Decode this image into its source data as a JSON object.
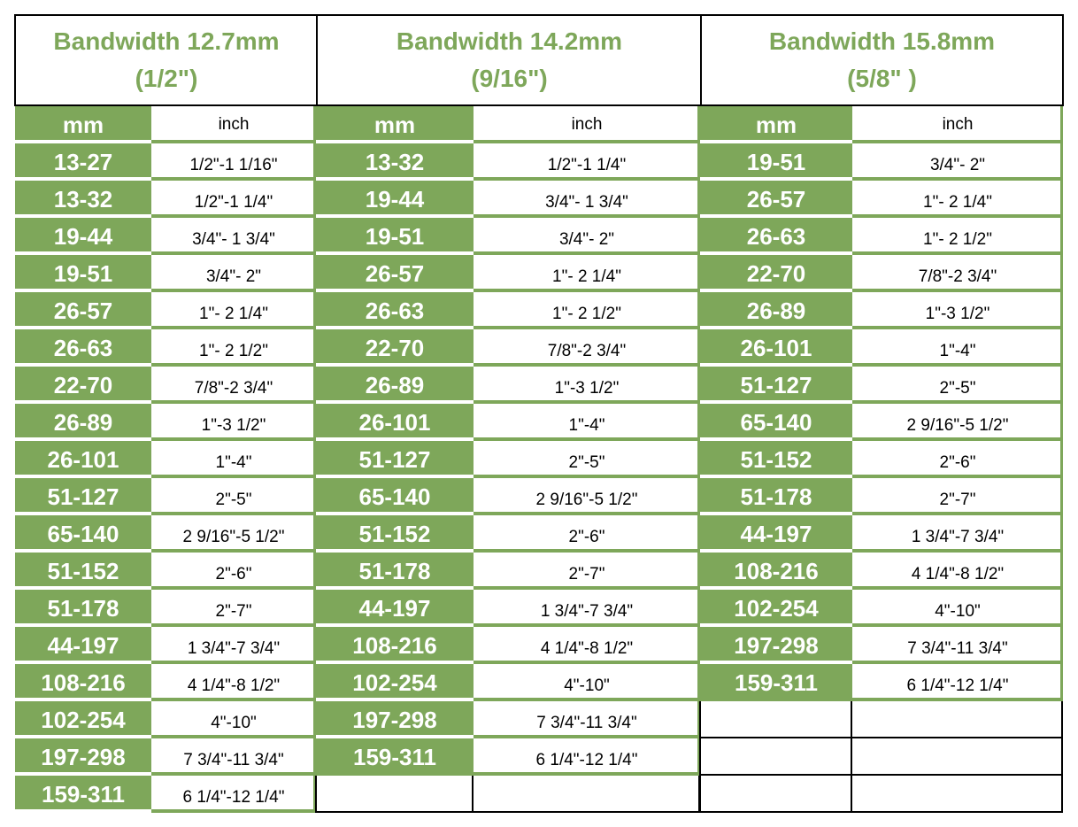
{
  "colors": {
    "accent_green": "#7ea75a",
    "text_dark": "#000000",
    "text_light": "#ffffff"
  },
  "column_labels": {
    "mm": "mm",
    "inch": "inch"
  },
  "groups": [
    {
      "title_line1": "Bandwidth 12.7mm",
      "title_line2": "(1/2\")",
      "rows": [
        {
          "mm": "13-27",
          "inch": "1/2\"-1 1/16\""
        },
        {
          "mm": "13-32",
          "inch": "1/2\"-1 1/4\""
        },
        {
          "mm": "19-44",
          "inch": "3/4\"- 1 3/4\""
        },
        {
          "mm": "19-51",
          "inch": "3/4\"- 2\""
        },
        {
          "mm": "26-57",
          "inch": "1\"- 2 1/4\""
        },
        {
          "mm": "26-63",
          "inch": "1\"- 2 1/2\""
        },
        {
          "mm": "22-70",
          "inch": "7/8\"-2 3/4\""
        },
        {
          "mm": "26-89",
          "inch": "1\"-3 1/2\""
        },
        {
          "mm": "26-101",
          "inch": "1\"-4\""
        },
        {
          "mm": "51-127",
          "inch": "2\"-5\""
        },
        {
          "mm": "65-140",
          "inch": "2 9/16\"-5 1/2\""
        },
        {
          "mm": "51-152",
          "inch": "2\"-6\""
        },
        {
          "mm": "51-178",
          "inch": "2\"-7\""
        },
        {
          "mm": "44-197",
          "inch": "1 3/4\"-7 3/4\""
        },
        {
          "mm": "108-216",
          "inch": "4 1/4\"-8 1/2\""
        },
        {
          "mm": "102-254",
          "inch": "4\"-10\""
        },
        {
          "mm": "197-298",
          "inch": "7 3/4\"-11 3/4\""
        },
        {
          "mm": "159-311",
          "inch": "6 1/4\"-12 1/4\""
        }
      ]
    },
    {
      "title_line1": "Bandwidth 14.2mm",
      "title_line2": "(9/16\")",
      "rows": [
        {
          "mm": "13-32",
          "inch": "1/2\"-1 1/4\""
        },
        {
          "mm": "19-44",
          "inch": "3/4\"- 1 3/4\""
        },
        {
          "mm": "19-51",
          "inch": "3/4\"- 2\""
        },
        {
          "mm": "26-57",
          "inch": "1\"- 2 1/4\""
        },
        {
          "mm": "26-63",
          "inch": "1\"- 2 1/2\""
        },
        {
          "mm": "22-70",
          "inch": "7/8\"-2 3/4\""
        },
        {
          "mm": "26-89",
          "inch": "1\"-3 1/2\""
        },
        {
          "mm": "26-101",
          "inch": "1\"-4\""
        },
        {
          "mm": "51-127",
          "inch": "2\"-5\""
        },
        {
          "mm": "65-140",
          "inch": "2 9/16\"-5 1/2\""
        },
        {
          "mm": "51-152",
          "inch": "2\"-6\""
        },
        {
          "mm": "51-178",
          "inch": "2\"-7\""
        },
        {
          "mm": "44-197",
          "inch": "1 3/4\"-7 3/4\""
        },
        {
          "mm": "108-216",
          "inch": "4 1/4\"-8 1/2\""
        },
        {
          "mm": "102-254",
          "inch": "4\"-10\""
        },
        {
          "mm": "197-298",
          "inch": "7 3/4\"-11 3/4\""
        },
        {
          "mm": "159-311",
          "inch": "6 1/4\"-12 1/4\""
        }
      ]
    },
    {
      "title_line1": "Bandwidth 15.8mm",
      "title_line2": "(5/8\" )",
      "rows": [
        {
          "mm": "19-51",
          "inch": "3/4\"- 2\""
        },
        {
          "mm": "26-57",
          "inch": "1\"- 2 1/4\""
        },
        {
          "mm": "26-63",
          "inch": "1\"- 2 1/2\""
        },
        {
          "mm": "22-70",
          "inch": "7/8\"-2 3/4\""
        },
        {
          "mm": "26-89",
          "inch": "1\"-3 1/2\""
        },
        {
          "mm": "26-101",
          "inch": "1\"-4\""
        },
        {
          "mm": "51-127",
          "inch": "2\"-5\""
        },
        {
          "mm": "65-140",
          "inch": "2 9/16\"-5 1/2\""
        },
        {
          "mm": "51-152",
          "inch": "2\"-6\""
        },
        {
          "mm": "51-178",
          "inch": "2\"-7\""
        },
        {
          "mm": "44-197",
          "inch": "1 3/4\"-7 3/4\""
        },
        {
          "mm": "108-216",
          "inch": "4 1/4\"-8 1/2\""
        },
        {
          "mm": "102-254",
          "inch": "4\"-10\""
        },
        {
          "mm": "197-298",
          "inch": "7 3/4\"-11 3/4\""
        },
        {
          "mm": "159-311",
          "inch": "6 1/4\"-12 1/4\""
        }
      ]
    }
  ]
}
